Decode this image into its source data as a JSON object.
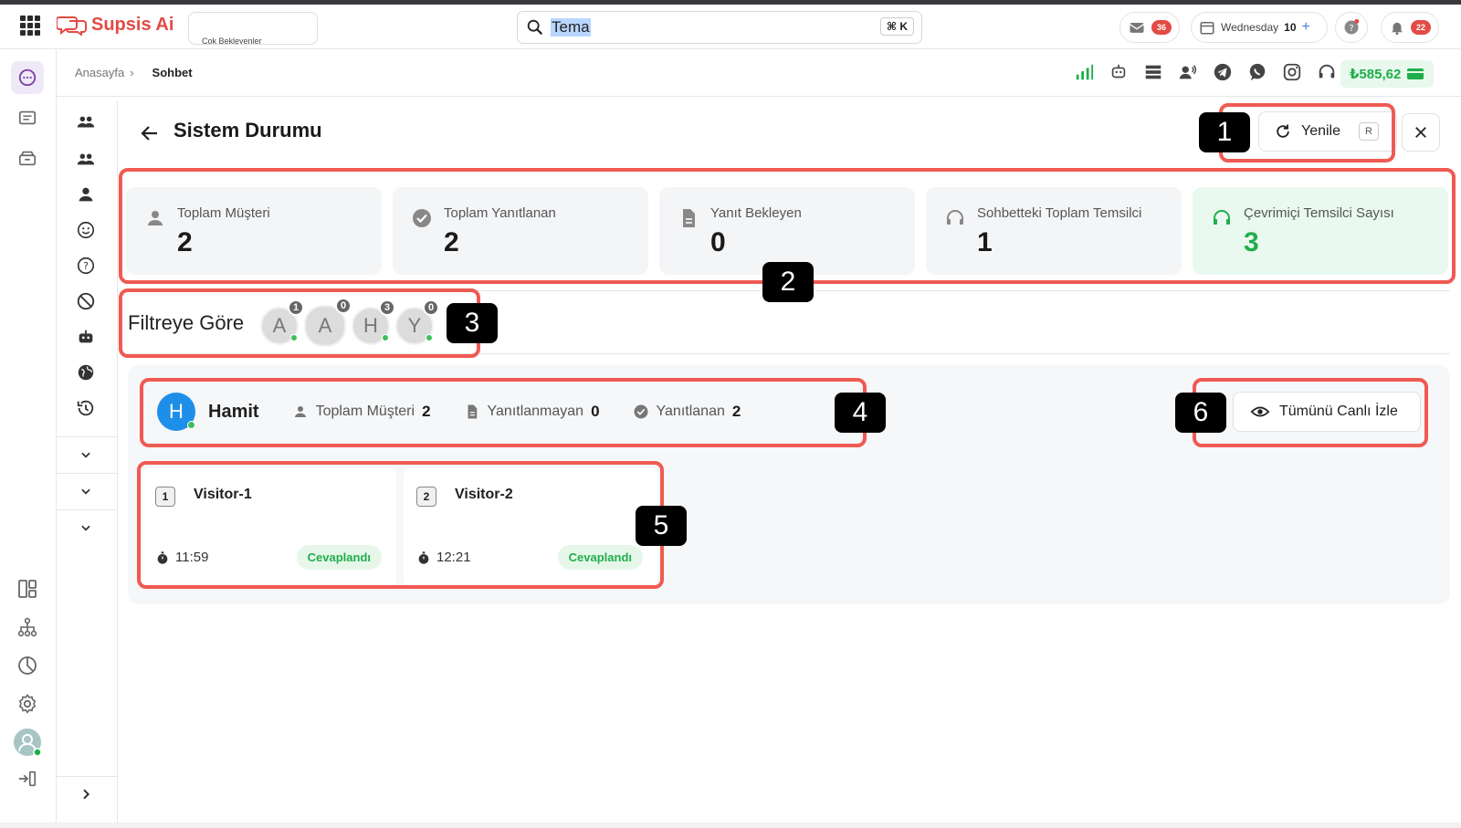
{
  "app": {
    "brand": "Supsis Ai",
    "pending_label": "Çok Bekleyenler",
    "search_value": "Tema",
    "search_shortcut": "⌘ K",
    "messages_count": "36",
    "day_label": "Wednesday",
    "day_number": "10",
    "notifications_count": "22"
  },
  "breadcrumb": {
    "home": "Anasayfa",
    "sep": "›",
    "current": "Sohbet"
  },
  "balance": "₺585,62",
  "page": {
    "title": "Sistem Durumu",
    "refresh_label": "Yenile",
    "refresh_key": "R"
  },
  "stats": [
    {
      "label": "Toplam Müşteri",
      "value": "2",
      "icon": "person-icon"
    },
    {
      "label": "Toplam Yanıtlanan",
      "value": "2",
      "icon": "check-circle-icon"
    },
    {
      "label": "Yanıt Bekleyen",
      "value": "0",
      "icon": "document-icon"
    },
    {
      "label": "Sohbetteki Toplam Temsilci",
      "value": "1",
      "icon": "headset-icon"
    },
    {
      "label": "Çevrimiçi Temsilci Sayısı",
      "value": "3",
      "icon": "headset-icon"
    }
  ],
  "filter": {
    "label": "Filtreye Göre",
    "agents": [
      {
        "initial": "A",
        "count": "1"
      },
      {
        "initial": "A",
        "count": "0"
      },
      {
        "initial": "H",
        "count": "3"
      },
      {
        "initial": "Y",
        "count": "0"
      }
    ]
  },
  "agent": {
    "initial": "H",
    "name": "Hamit",
    "total_label": "Toplam Müşteri",
    "total_value": "2",
    "unanswered_label": "Yanıtlanmayan",
    "unanswered_value": "0",
    "answered_label": "Yanıtlanan",
    "answered_value": "2",
    "watch_all_label": "Tümünü Canlı İzle"
  },
  "visitors": [
    {
      "index": "1",
      "name": "Visitor-1",
      "time": "11:59",
      "status": "Cevaplandı"
    },
    {
      "index": "2",
      "name": "Visitor-2",
      "time": "12:21",
      "status": "Cevaplandı"
    }
  ],
  "callouts": [
    "1",
    "2",
    "3",
    "4",
    "5",
    "6"
  ],
  "colors": {
    "accent_red": "#e24b45",
    "success_green": "#1fae4b",
    "highlight": "#ef5a52",
    "agent_blue": "#1e8fe9"
  }
}
